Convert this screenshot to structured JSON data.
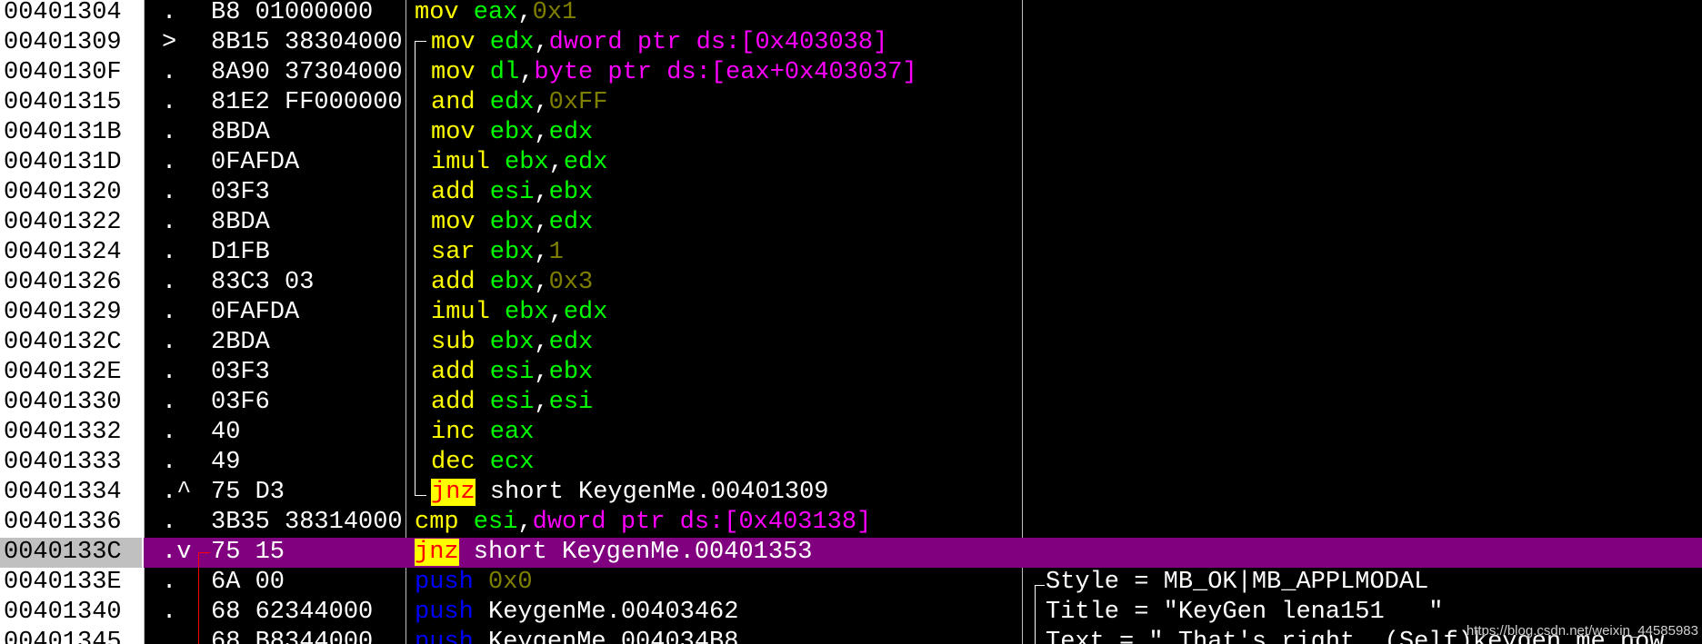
{
  "rows": [
    {
      "addr": "00401304",
      "mark": ".",
      "hex": "B8 01000000",
      "parts": [
        {
          "t": "mov",
          "c": "mn"
        },
        {
          "t": " eax",
          "c": "op"
        },
        {
          "t": ",",
          "c": "txt"
        },
        {
          "t": "0x1",
          "c": "num"
        }
      ],
      "indent": false
    },
    {
      "addr": "00401309",
      "mark": ">",
      "hex": "8B15 38304000",
      "parts": [
        {
          "t": "mov",
          "c": "mn"
        },
        {
          "t": " edx",
          "c": "op"
        },
        {
          "t": ",",
          "c": "txt"
        },
        {
          "t": "dword ptr ds:[0x403038]",
          "c": "mem"
        }
      ],
      "indent": true
    },
    {
      "addr": "0040130F",
      "mark": ".",
      "hex": "8A90 37304000",
      "parts": [
        {
          "t": "mov",
          "c": "mn"
        },
        {
          "t": " dl",
          "c": "op"
        },
        {
          "t": ",",
          "c": "txt"
        },
        {
          "t": "byte ptr ds:[eax+0x403037]",
          "c": "mem"
        }
      ],
      "indent": true
    },
    {
      "addr": "00401315",
      "mark": ".",
      "hex": "81E2 FF000000",
      "parts": [
        {
          "t": "and",
          "c": "mn"
        },
        {
          "t": " edx",
          "c": "op"
        },
        {
          "t": ",",
          "c": "txt"
        },
        {
          "t": "0xFF",
          "c": "num"
        }
      ],
      "indent": true
    },
    {
      "addr": "0040131B",
      "mark": ".",
      "hex": "8BDA",
      "parts": [
        {
          "t": "mov",
          "c": "mn"
        },
        {
          "t": " ebx",
          "c": "op"
        },
        {
          "t": ",",
          "c": "txt"
        },
        {
          "t": "edx",
          "c": "op"
        }
      ],
      "indent": true
    },
    {
      "addr": "0040131D",
      "mark": ".",
      "hex": "0FAFDA",
      "parts": [
        {
          "t": "imul",
          "c": "mn"
        },
        {
          "t": " ebx",
          "c": "op"
        },
        {
          "t": ",",
          "c": "txt"
        },
        {
          "t": "edx",
          "c": "op"
        }
      ],
      "indent": true
    },
    {
      "addr": "00401320",
      "mark": ".",
      "hex": "03F3",
      "parts": [
        {
          "t": "add",
          "c": "mn"
        },
        {
          "t": " esi",
          "c": "op"
        },
        {
          "t": ",",
          "c": "txt"
        },
        {
          "t": "ebx",
          "c": "op"
        }
      ],
      "indent": true
    },
    {
      "addr": "00401322",
      "mark": ".",
      "hex": "8BDA",
      "parts": [
        {
          "t": "mov",
          "c": "mn"
        },
        {
          "t": " ebx",
          "c": "op"
        },
        {
          "t": ",",
          "c": "txt"
        },
        {
          "t": "edx",
          "c": "op"
        }
      ],
      "indent": true
    },
    {
      "addr": "00401324",
      "mark": ".",
      "hex": "D1FB",
      "parts": [
        {
          "t": "sar",
          "c": "mn"
        },
        {
          "t": " ebx",
          "c": "op"
        },
        {
          "t": ",",
          "c": "txt"
        },
        {
          "t": "1",
          "c": "num"
        }
      ],
      "indent": true
    },
    {
      "addr": "00401326",
      "mark": ".",
      "hex": "83C3 03",
      "parts": [
        {
          "t": "add",
          "c": "mn"
        },
        {
          "t": " ebx",
          "c": "op"
        },
        {
          "t": ",",
          "c": "txt"
        },
        {
          "t": "0x3",
          "c": "num"
        }
      ],
      "indent": true
    },
    {
      "addr": "00401329",
      "mark": ".",
      "hex": "0FAFDA",
      "parts": [
        {
          "t": "imul",
          "c": "mn"
        },
        {
          "t": " ebx",
          "c": "op"
        },
        {
          "t": ",",
          "c": "txt"
        },
        {
          "t": "edx",
          "c": "op"
        }
      ],
      "indent": true
    },
    {
      "addr": "0040132C",
      "mark": ".",
      "hex": "2BDA",
      "parts": [
        {
          "t": "sub",
          "c": "mn"
        },
        {
          "t": " ebx",
          "c": "op"
        },
        {
          "t": ",",
          "c": "txt"
        },
        {
          "t": "edx",
          "c": "op"
        }
      ],
      "indent": true
    },
    {
      "addr": "0040132E",
      "mark": ".",
      "hex": "03F3",
      "parts": [
        {
          "t": "add",
          "c": "mn"
        },
        {
          "t": " esi",
          "c": "op"
        },
        {
          "t": ",",
          "c": "txt"
        },
        {
          "t": "ebx",
          "c": "op"
        }
      ],
      "indent": true
    },
    {
      "addr": "00401330",
      "mark": ".",
      "hex": "03F6",
      "parts": [
        {
          "t": "add",
          "c": "mn"
        },
        {
          "t": " esi",
          "c": "op"
        },
        {
          "t": ",",
          "c": "txt"
        },
        {
          "t": "esi",
          "c": "op"
        }
      ],
      "indent": true
    },
    {
      "addr": "00401332",
      "mark": ".",
      "hex": "40",
      "parts": [
        {
          "t": "inc",
          "c": "mn"
        },
        {
          "t": " eax",
          "c": "op"
        }
      ],
      "indent": true
    },
    {
      "addr": "00401333",
      "mark": ".",
      "hex": "49",
      "parts": [
        {
          "t": "dec",
          "c": "mn"
        },
        {
          "t": " ecx",
          "c": "op"
        }
      ],
      "indent": true
    },
    {
      "addr": "00401334",
      "mark": ".^",
      "hex": "75 D3",
      "parts": [
        {
          "t": "jnz",
          "c": "mn hl"
        },
        {
          "t": " short KeygenMe.00401309",
          "c": "txt"
        }
      ],
      "indent": true
    },
    {
      "addr": "00401336",
      "mark": ".",
      "hex": "3B35 38314000",
      "parts": [
        {
          "t": "cmp",
          "c": "mn"
        },
        {
          "t": " esi",
          "c": "op"
        },
        {
          "t": ",",
          "c": "txt"
        },
        {
          "t": "dword ptr ds:[0x403138]",
          "c": "mem"
        }
      ],
      "indent": false
    },
    {
      "addr": "0040133C",
      "mark": ".v",
      "hex": "75 15",
      "parts": [
        {
          "t": "jnz",
          "c": "mn hl"
        },
        {
          "t": " short KeygenMe.00401353",
          "c": "txt"
        }
      ],
      "indent": false,
      "selected": true
    },
    {
      "addr": "0040133E",
      "mark": ".",
      "hex": "6A 00",
      "parts": [
        {
          "t": "push",
          "c": "mn push"
        },
        {
          "t": " 0x0",
          "c": "num"
        }
      ],
      "indent": false,
      "comment": "Style = MB_OK|MB_APPLMODAL"
    },
    {
      "addr": "00401340",
      "mark": ".",
      "hex": "68 62344000",
      "parts": [
        {
          "t": "push",
          "c": "mn push"
        },
        {
          "t": " KeygenMe.00403462",
          "c": "txt"
        }
      ],
      "indent": false,
      "comment": "Title = \"KeyGen lena151   \""
    },
    {
      "addr": "00401345",
      "mark": ".",
      "hex": "68 B8344000",
      "parts": [
        {
          "t": "push",
          "c": "mn push"
        },
        {
          "t": " KeygenMe.004034B8",
          "c": "txt"
        }
      ],
      "indent": false,
      "comment": "Text = \" That's right. (Self)keygen me now"
    }
  ],
  "watermark": "https://blog.csdn.net/weixin_44585983"
}
